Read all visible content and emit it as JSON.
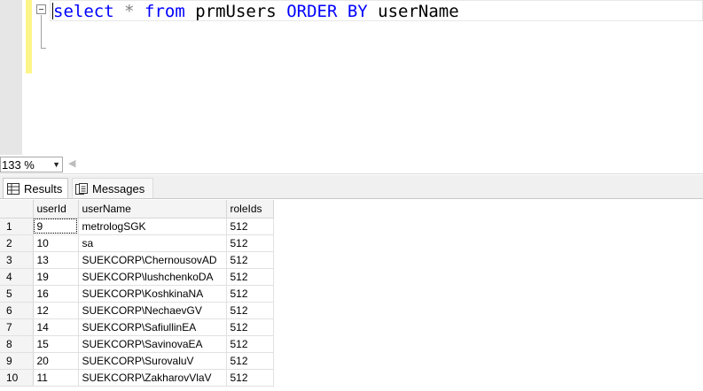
{
  "editor": {
    "query": {
      "kw_select": "select",
      "star": "*",
      "kw_from": "from",
      "table": "prmUsers",
      "kw_order_by": "ORDER BY",
      "column": "userName"
    }
  },
  "zoom": {
    "value": "133 %"
  },
  "tabs": [
    {
      "label": "Results",
      "icon": "grid-icon",
      "active": true
    },
    {
      "label": "Messages",
      "icon": "messages-icon",
      "active": false
    }
  ],
  "grid": {
    "columns": [
      "userId",
      "userName",
      "roleIds"
    ],
    "rows": [
      {
        "n": "1",
        "userId": "9",
        "userName": "metrologSGK",
        "roleIds": "512"
      },
      {
        "n": "2",
        "userId": "10",
        "userName": "sa",
        "roleIds": "512"
      },
      {
        "n": "3",
        "userId": "13",
        "userName": "SUEKCORP\\ChernousovAD",
        "roleIds": "512"
      },
      {
        "n": "4",
        "userId": "19",
        "userName": "SUEKCORP\\lushchenkoDA",
        "roleIds": "512"
      },
      {
        "n": "5",
        "userId": "16",
        "userName": "SUEKCORP\\KoshkinaNA",
        "roleIds": "512"
      },
      {
        "n": "6",
        "userId": "12",
        "userName": "SUEKCORP\\NechaevGV",
        "roleIds": "512"
      },
      {
        "n": "7",
        "userId": "14",
        "userName": "SUEKCORP\\SafiullinEA",
        "roleIds": "512"
      },
      {
        "n": "8",
        "userId": "15",
        "userName": "SUEKCORP\\SavinovaEA",
        "roleIds": "512"
      },
      {
        "n": "9",
        "userId": "20",
        "userName": "SUEKCORP\\SurovaluV",
        "roleIds": "512"
      },
      {
        "n": "10",
        "userId": "11",
        "userName": "SUEKCORP\\ZakharovVlaV",
        "roleIds": "512"
      }
    ]
  }
}
